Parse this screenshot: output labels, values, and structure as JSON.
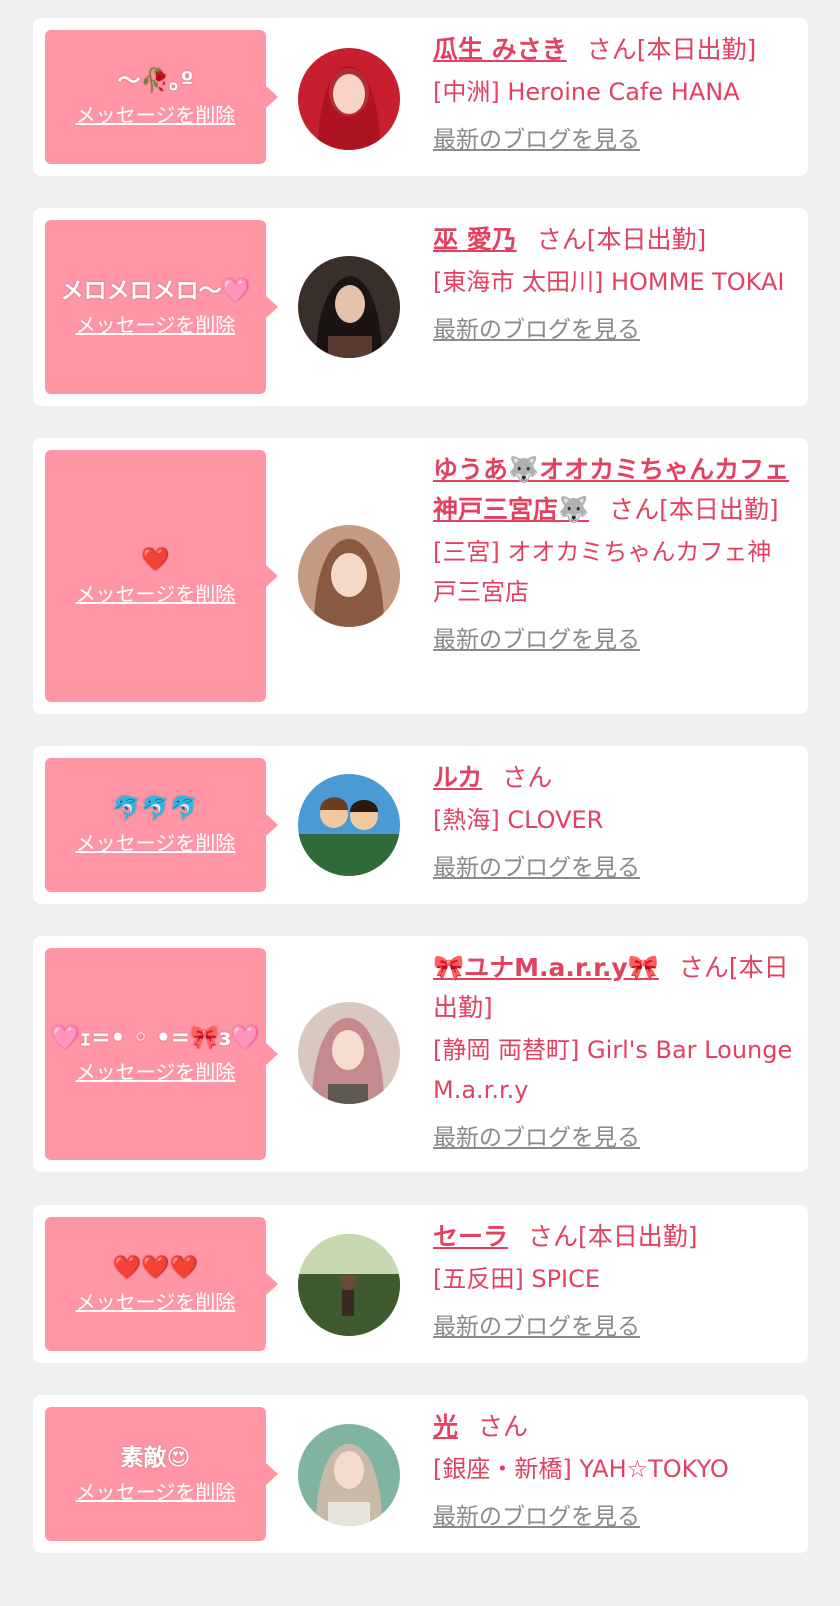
{
  "items": [
    {
      "message": "〜🥀｡º",
      "delete_label": "メッセージを削除",
      "name": "瓜生 みさき",
      "suffix": "さん[本日出勤]",
      "shop": "[中洲] Heroine Cafe HANA",
      "blog_label": "最新のブログを見る",
      "avatar_bg": "#c81f2e"
    },
    {
      "message": "メロメロメロ〜🩷",
      "delete_label": "メッセージを削除",
      "name": "巫 愛乃",
      "suffix": "さん[本日出勤]",
      "shop": "[東海市 太田川] HOMME TOKAI",
      "blog_label": "最新のブログを見る",
      "avatar_bg": "#3a2e2a"
    },
    {
      "message": "❤️",
      "delete_label": "メッセージを削除",
      "name": "ゆうあ🐺オオカミちゃんカフェ神戸三宮店🐺",
      "suffix": "さん[本日出勤]",
      "shop": "[三宮] オオカミちゃんカフェ神戸三宮店",
      "blog_label": "最新のブログを見る",
      "avatar_bg": "#c59a82"
    },
    {
      "message": "🐬🐬🐬",
      "delete_label": "メッセージを削除",
      "name": "ルカ",
      "suffix": "さん",
      "shop": "[熱海] CLOVER",
      "blog_label": "最新のブログを見る",
      "avatar_bg": "#4a9ad4"
    },
    {
      "message": "🩷ｪ=• ◦ •=🎀ɜ🩷",
      "delete_label": "メッセージを削除",
      "name": "🎀ユナM.a.r.r.y🎀",
      "suffix": "さん[本日出勤]",
      "shop": "[静岡 両替町] Girl's Bar Lounge M.a.r.r.y",
      "blog_label": "最新のブログを見る",
      "avatar_bg": "#d9a8a8"
    },
    {
      "message": "❤️❤️❤️",
      "delete_label": "メッセージを削除",
      "name": "セーラ",
      "suffix": "さん[本日出勤]",
      "shop": "[五反田] SPICE",
      "blog_label": "最新のブログを見る",
      "avatar_bg": "#3f5a2e"
    },
    {
      "message": "素敵😍",
      "delete_label": "メッセージを削除",
      "name": "光",
      "suffix": "さん",
      "shop": "[銀座・新橋] YAH☆TOKYO",
      "blog_label": "最新のブログを見る",
      "avatar_bg": "#7fb4a0"
    }
  ]
}
